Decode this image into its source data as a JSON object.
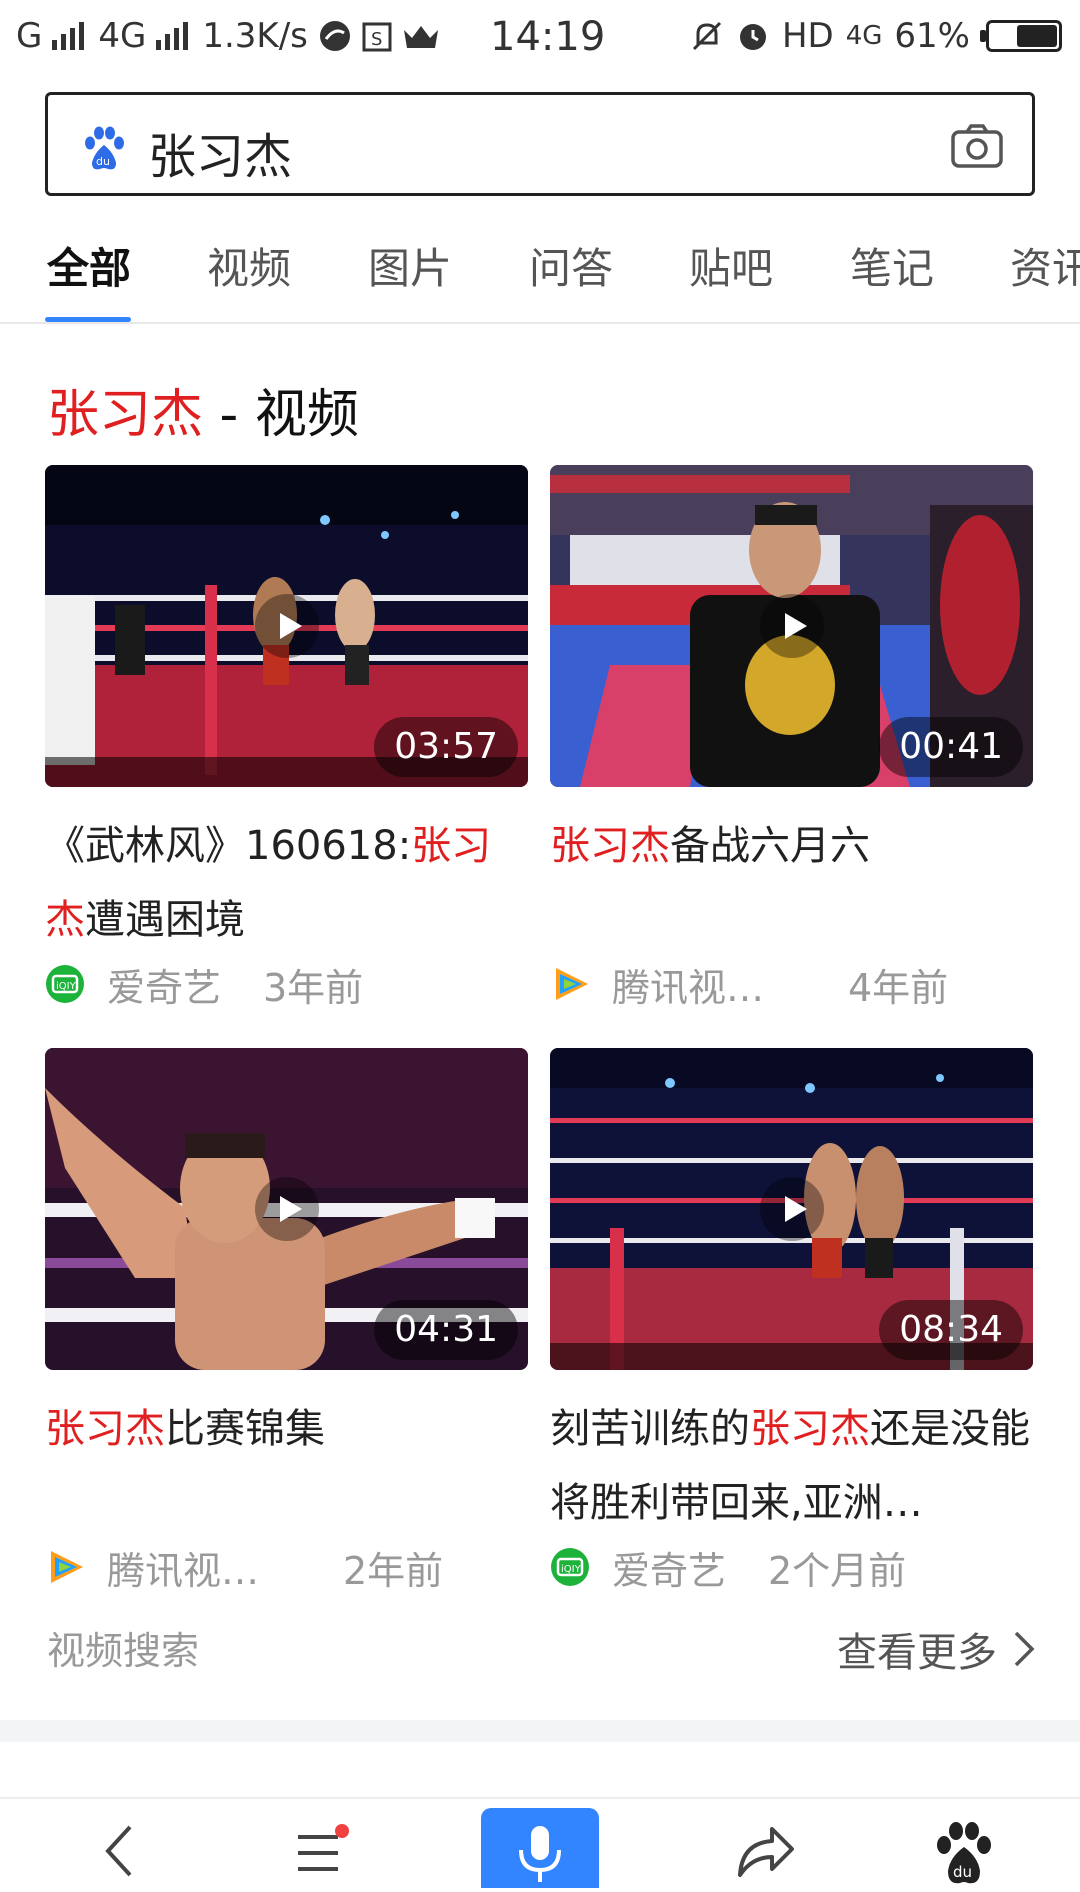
{
  "status_bar": {
    "network_left": "G",
    "network_4g": "4G",
    "speed": "1.3K/s",
    "time": "14:19",
    "hd": "HD",
    "network_right": "4G",
    "battery_percent": "61%",
    "battery_level": 0.61
  },
  "search": {
    "query": "张习杰"
  },
  "tabs": [
    {
      "label": "全部",
      "active": true
    },
    {
      "label": "视频"
    },
    {
      "label": "图片"
    },
    {
      "label": "问答"
    },
    {
      "label": "贴吧"
    },
    {
      "label": "笔记"
    },
    {
      "label": "资讯"
    }
  ],
  "section": {
    "keyword": "张习杰",
    "suffix": " - 视频"
  },
  "videos": [
    {
      "title_parts": [
        "《武林风》160618:",
        "张习杰",
        "遭遇困境"
      ],
      "duration": "03:57",
      "source": "爱奇艺",
      "source_icon": "iqiyi-icon",
      "age": "3年前"
    },
    {
      "title_parts": [
        "",
        "张习杰",
        "备战六月六"
      ],
      "duration": "00:41",
      "source": "腾讯视…",
      "source_icon": "tencent-video-icon",
      "age": "4年前"
    },
    {
      "title_parts": [
        "",
        "张习杰",
        "比赛锦集"
      ],
      "duration": "04:31",
      "source": "腾讯视…",
      "source_icon": "tencent-video-icon",
      "age": "2年前"
    },
    {
      "title_parts": [
        "刻苦训练的",
        "张习杰",
        "还是没能将胜利带回来,亚洲…"
      ],
      "duration": "08:34",
      "source": "爱奇艺",
      "source_icon": "iqiyi-icon",
      "age": "2个月前"
    }
  ],
  "footer": {
    "left": "视频搜索",
    "right": "查看更多"
  },
  "colors": {
    "accent": "#3385ff",
    "highlight": "#e02020"
  }
}
